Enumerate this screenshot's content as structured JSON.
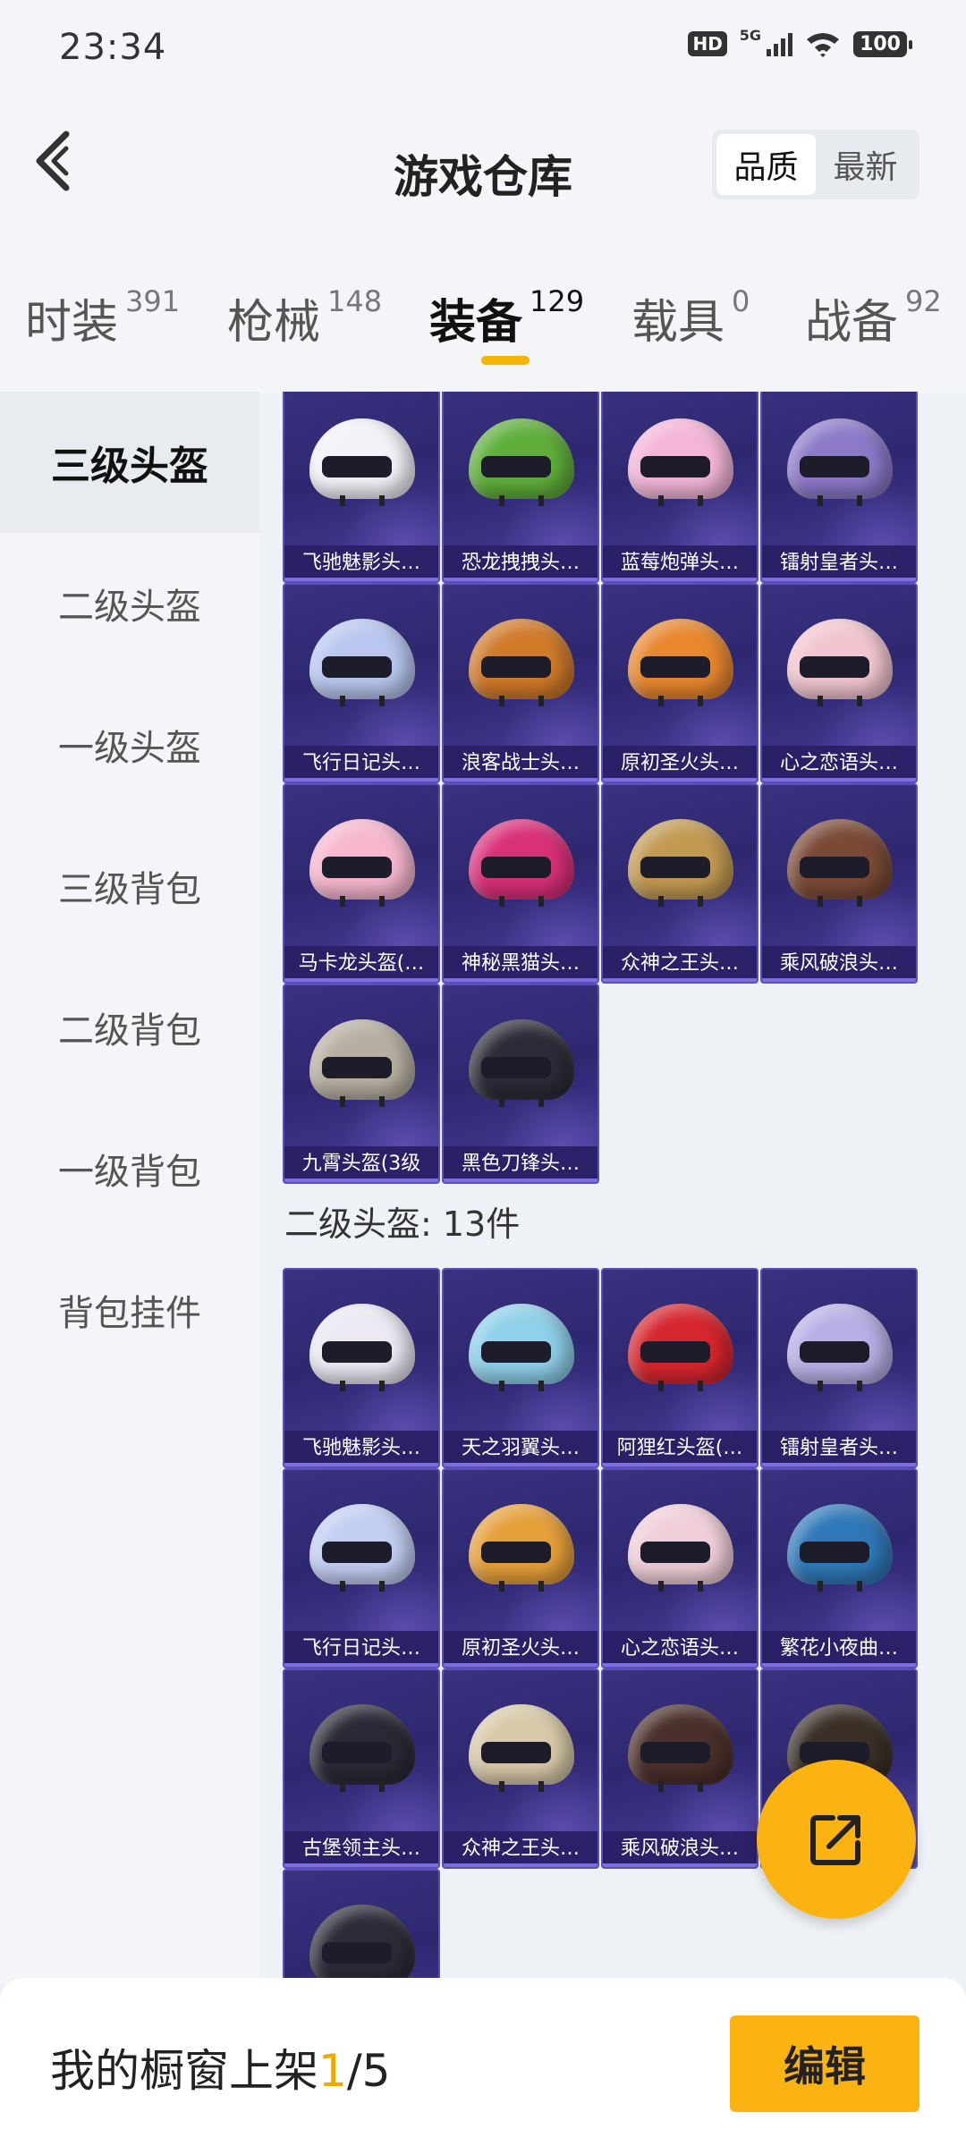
{
  "status_bar": {
    "time": "23:34",
    "hd": "HD",
    "network": "5G",
    "battery": "100"
  },
  "header": {
    "title": "游戏仓库",
    "sort_options": [
      "品质",
      "最新"
    ],
    "sort_selected": "品质"
  },
  "tabs": [
    {
      "label": "时装",
      "count": "391"
    },
    {
      "label": "枪械",
      "count": "148"
    },
    {
      "label": "装备",
      "count": "129",
      "active": true
    },
    {
      "label": "载具",
      "count": "0"
    },
    {
      "label": "战备",
      "count": "92"
    }
  ],
  "sidebar": {
    "items": [
      {
        "label": "三级头盔",
        "active": true
      },
      {
        "label": "二级头盔"
      },
      {
        "label": "一级头盔"
      },
      {
        "label": "三级背包"
      },
      {
        "label": "二级背包"
      },
      {
        "label": "一级背包"
      },
      {
        "label": "背包挂件"
      }
    ]
  },
  "sections": [
    {
      "title": "",
      "items": [
        {
          "name": "飞驰魅影头…",
          "color": "#f2f2f8"
        },
        {
          "name": "恐龙拽拽头…",
          "color": "#5fae3a"
        },
        {
          "name": "蓝莓炮弹头…",
          "color": "#f4b6d8"
        },
        {
          "name": "镭射皇者头…",
          "color": "#8c79c8"
        },
        {
          "name": "飞行日记头…",
          "color": "#b9c8f0"
        },
        {
          "name": "浪客战士头…",
          "color": "#d07a2a"
        },
        {
          "name": "原初圣火头…",
          "color": "#e8872e"
        },
        {
          "name": "心之恋语头…",
          "color": "#f2c6cf"
        },
        {
          "name": "马卡龙头盔(…",
          "color": "#f7b8cf"
        },
        {
          "name": "神秘黑猫头…",
          "color": "#d9307a"
        },
        {
          "name": "众神之王头…",
          "color": "#c29a52"
        },
        {
          "name": "乘风破浪头…",
          "color": "#7a4a36"
        },
        {
          "name": "九霄头盔(3级",
          "color": "#b7b0a2"
        },
        {
          "name": "黑色刀锋头…",
          "color": "#2c2c38"
        }
      ]
    },
    {
      "title": "二级头盔: 13件",
      "items": [
        {
          "name": "飞驰魅影头…",
          "color": "#ece9f2"
        },
        {
          "name": "天之羽翼头…",
          "color": "#8fd0ea"
        },
        {
          "name": "阿狸红头盔(…",
          "color": "#d6262e"
        },
        {
          "name": "镭射皇者头…",
          "color": "#b8b0e6"
        },
        {
          "name": "飞行日记头…",
          "color": "#c3cff2"
        },
        {
          "name": "原初圣火头…",
          "color": "#e6a03a"
        },
        {
          "name": "心之恋语头…",
          "color": "#f0cfd8"
        },
        {
          "name": "繁花小夜曲…",
          "color": "#2f78b8"
        },
        {
          "name": "古堡领主头…",
          "color": "#2a2a36"
        },
        {
          "name": "众神之王头…",
          "color": "#d8c9a8"
        },
        {
          "name": "乘风破浪头…",
          "color": "#4a2f2a"
        },
        {
          "name": "",
          "color": "#3a3028"
        },
        {
          "name": "",
          "color": "#2c2c38"
        }
      ]
    }
  ],
  "bottom_bar": {
    "label_prefix": "我的橱窗上架",
    "label_current": "1",
    "label_total": "/5",
    "edit_label": "编辑"
  },
  "icons": {
    "back": "chevron-left-icon",
    "fab": "share-external-icon"
  },
  "colors": {
    "accent": "#fbb311",
    "card": "#2e2770"
  }
}
